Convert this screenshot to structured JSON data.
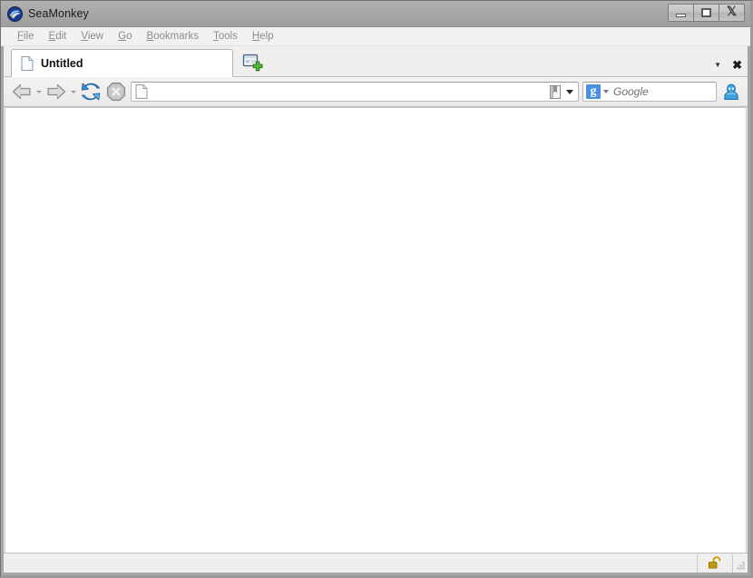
{
  "window": {
    "title": "SeaMonkey",
    "app_logo_icon": "seamonkey-logo-icon",
    "controls": {
      "minimize_label": "Minimize",
      "maximize_label": "Maximize",
      "close_label": "Close"
    },
    "colors": {
      "titlebar": "#a6a6a6",
      "chrome": "#f0efee",
      "content": "#ffffff",
      "accent_blue": "#4a90e2",
      "lock_gold": "#c8a000",
      "green_plus": "#4aa33a"
    }
  },
  "menubar": {
    "items": [
      {
        "label": "File",
        "accesskey": "F",
        "name": "menu-file"
      },
      {
        "label": "Edit",
        "accesskey": "E",
        "name": "menu-edit"
      },
      {
        "label": "View",
        "accesskey": "V",
        "name": "menu-view"
      },
      {
        "label": "Go",
        "accesskey": "G",
        "name": "menu-go"
      },
      {
        "label": "Bookmarks",
        "accesskey": "B",
        "name": "menu-bookmarks"
      },
      {
        "label": "Tools",
        "accesskey": "T",
        "name": "menu-tools"
      },
      {
        "label": "Help",
        "accesskey": "H",
        "name": "menu-help"
      }
    ]
  },
  "tabbar": {
    "tabs": [
      {
        "label": "Untitled",
        "favicon_icon": "blank-page-icon",
        "active": true
      }
    ],
    "new_tab_icon": "new-tab-plus-icon",
    "tab_list_dropdown_icon": "chevron-down-icon",
    "close_tab_icon": "close-x-icon"
  },
  "navbar": {
    "back": {
      "label": "Back",
      "icon": "back-arrow-icon",
      "enabled": false
    },
    "forward": {
      "label": "Forward",
      "icon": "forward-arrow-icon",
      "enabled": false
    },
    "reload": {
      "label": "Reload",
      "icon": "reload-icon",
      "enabled": true
    },
    "stop": {
      "label": "Stop",
      "icon": "stop-icon",
      "enabled": false
    },
    "location": {
      "icon": "blank-page-icon",
      "value": "",
      "placeholder": "",
      "bookmark_icon": "bookmark-icon",
      "dropdown_icon": "chevron-down-icon"
    },
    "search": {
      "engine_name": "Google",
      "engine_glyph": "g",
      "engine_icon": "google-search-icon",
      "dropdown_icon": "chevron-down-icon",
      "value": "",
      "placeholder": "Google"
    },
    "sidebar_toggle": {
      "label": "Sidebar",
      "icon": "contact-sidebar-icon"
    }
  },
  "content": {
    "page_text": ""
  },
  "statusbar": {
    "status_text": "",
    "security_icon": "unlocked-padlock-icon",
    "security_state": "unsecured",
    "resize_grip_icon": "resize-grip-icon"
  }
}
